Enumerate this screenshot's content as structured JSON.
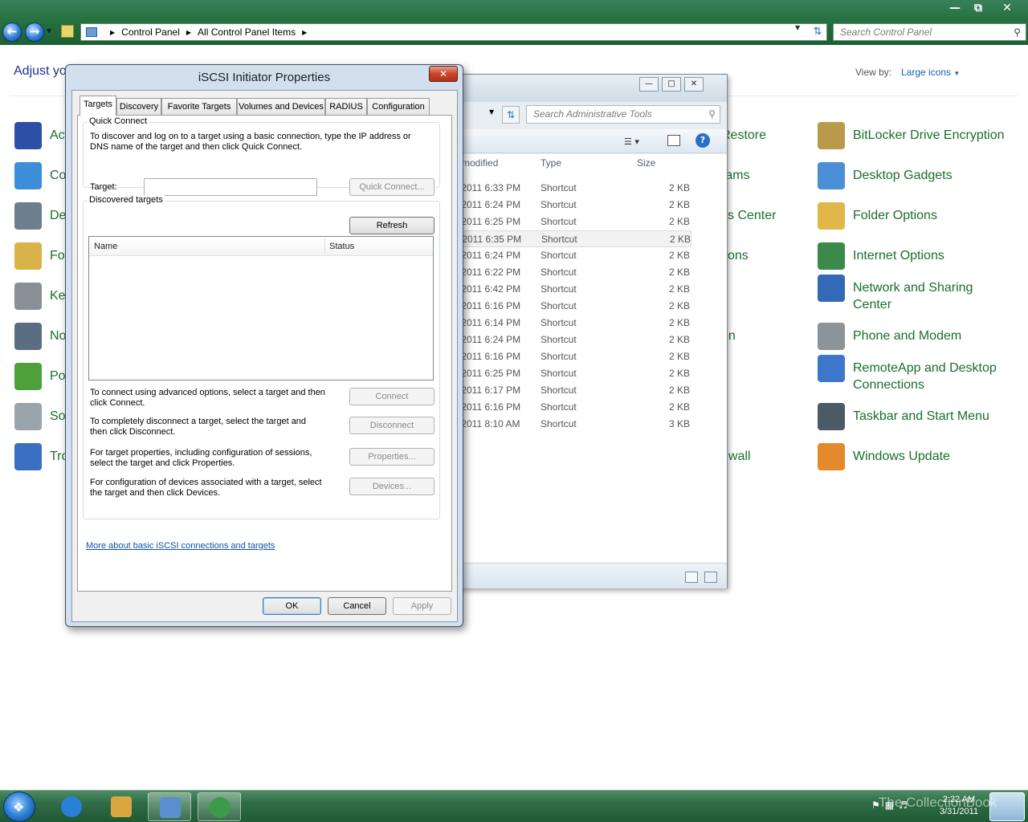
{
  "control_panel": {
    "breadcrumb": [
      "Control Panel",
      "All Control Panel Items"
    ],
    "search_placeholder": "Search Control Panel",
    "heading": "Adjust yo",
    "view_by_label": "View by:",
    "view_by_value": "Large icons",
    "left_column": [
      {
        "label": "Acti",
        "icon": "action-center-icon",
        "color": "#2c4fa8"
      },
      {
        "label": "Colo",
        "icon": "color-management-icon",
        "color": "#3c8fd8"
      },
      {
        "label": "Dev",
        "icon": "device-manager-icon",
        "color": "#6b7f8e"
      },
      {
        "label": "Fon",
        "icon": "fonts-icon",
        "color": "#d9b24a"
      },
      {
        "label": "Key",
        "icon": "keyboard-icon",
        "color": "#8a8f95"
      },
      {
        "label": "Not",
        "icon": "notification-area-icon",
        "color": "#5b6d80"
      },
      {
        "label": "Pow",
        "icon": "power-options-icon",
        "color": "#4ea13a"
      },
      {
        "label": "Sou",
        "icon": "sound-icon",
        "color": "#9aa4ad"
      },
      {
        "label": "Trou",
        "icon": "troubleshooting-icon",
        "color": "#3a6fc2"
      }
    ],
    "middle_column": [
      {
        "label": "Restore"
      },
      {
        "label": "rams"
      },
      {
        "label": "ss Center"
      },
      {
        "label": "tions"
      },
      {
        "label": "on"
      },
      {
        "label": "ewall"
      }
    ],
    "right_column": [
      {
        "label": "BitLocker Drive Encryption",
        "icon": "bitlocker-icon",
        "color": "#b89a4a"
      },
      {
        "label": "Desktop Gadgets",
        "icon": "desktop-gadgets-icon",
        "color": "#4b8fd6"
      },
      {
        "label": "Folder Options",
        "icon": "folder-options-icon",
        "color": "#e2b74a"
      },
      {
        "label": "Internet Options",
        "icon": "internet-options-icon",
        "color": "#3b8a4a"
      },
      {
        "label": "Network and Sharing Center",
        "icon": "network-sharing-icon",
        "color": "#3469b8"
      },
      {
        "label": "Phone and Modem",
        "icon": "phone-modem-icon",
        "color": "#8c9499"
      },
      {
        "label": "RemoteApp and Desktop Connections",
        "icon": "remoteapp-icon",
        "color": "#3c77c9"
      },
      {
        "label": "Taskbar and Start Menu",
        "icon": "taskbar-start-icon",
        "color": "#4c5a66"
      },
      {
        "label": "Windows Update",
        "icon": "windows-update-icon",
        "color": "#e48a2c"
      }
    ]
  },
  "admin_tools": {
    "search_placeholder": "Search Administrative Tools",
    "columns": {
      "date": "e modified",
      "type": "Type",
      "size": "Size"
    },
    "rows": [
      {
        "date": "/2011 6:33 PM",
        "type": "Shortcut",
        "size": "2 KB"
      },
      {
        "date": "/2011 6:24 PM",
        "type": "Shortcut",
        "size": "2 KB"
      },
      {
        "date": "/2011 6:25 PM",
        "type": "Shortcut",
        "size": "2 KB"
      },
      {
        "date": "/2011 6:35 PM",
        "type": "Shortcut",
        "size": "2 KB"
      },
      {
        "date": "/2011 6:24 PM",
        "type": "Shortcut",
        "size": "2 KB"
      },
      {
        "date": "/2011 6:22 PM",
        "type": "Shortcut",
        "size": "2 KB"
      },
      {
        "date": "/2011 6:42 PM",
        "type": "Shortcut",
        "size": "2 KB"
      },
      {
        "date": "/2011 6:16 PM",
        "type": "Shortcut",
        "size": "2 KB"
      },
      {
        "date": "/2011 6:14 PM",
        "type": "Shortcut",
        "size": "2 KB"
      },
      {
        "date": "/2011 6:24 PM",
        "type": "Shortcut",
        "size": "2 KB"
      },
      {
        "date": "/2011 6:16 PM",
        "type": "Shortcut",
        "size": "2 KB"
      },
      {
        "date": "/2011 6:25 PM",
        "type": "Shortcut",
        "size": "2 KB"
      },
      {
        "date": "/2011 6:17 PM",
        "type": "Shortcut",
        "size": "2 KB"
      },
      {
        "date": "/2011 6:16 PM",
        "type": "Shortcut",
        "size": "2 KB"
      },
      {
        "date": "/2011 8:10 AM",
        "type": "Shortcut",
        "size": "3 KB"
      }
    ]
  },
  "dialog": {
    "title": "iSCSI Initiator Properties",
    "tabs": [
      "Targets",
      "Discovery",
      "Favorite Targets",
      "Volumes and Devices",
      "RADIUS",
      "Configuration"
    ],
    "quick_connect": {
      "group_label": "Quick Connect",
      "description": "To discover and log on to a target using a basic connection, type the IP address or DNS name of the target and then click Quick Connect.",
      "target_label": "Target:",
      "target_value": "",
      "button": "Quick Connect..."
    },
    "discovered": {
      "group_label": "Discovered targets",
      "refresh_button": "Refresh",
      "col_name": "Name",
      "col_status": "Status",
      "connect_text": "To connect using advanced options, select a target and then click Connect.",
      "connect_button": "Connect",
      "disconnect_text": "To completely disconnect a target, select the target and then click Disconnect.",
      "disconnect_button": "Disconnect",
      "properties_text": "For target properties, including configuration of sessions, select the target and click Properties.",
      "properties_button": "Properties...",
      "devices_text": "For configuration of devices associated with a target, select the target and then click Devices.",
      "devices_button": "Devices..."
    },
    "link": "More about basic iSCSI connections and targets",
    "ok": "OK",
    "cancel": "Cancel",
    "apply": "Apply"
  },
  "taskbar": {
    "items": [
      {
        "icon": "internet-explorer-icon",
        "color": "#2b7fd6"
      },
      {
        "icon": "windows-explorer-icon",
        "color": "#d9a640"
      },
      {
        "icon": "control-panel-icon",
        "color": "#5a8fce"
      },
      {
        "icon": "iscsi-initiator-icon",
        "color": "#3c9a4a"
      }
    ],
    "time": "2:22 AM",
    "date": "3/31/2011",
    "watermark": "The CollectionBook"
  }
}
